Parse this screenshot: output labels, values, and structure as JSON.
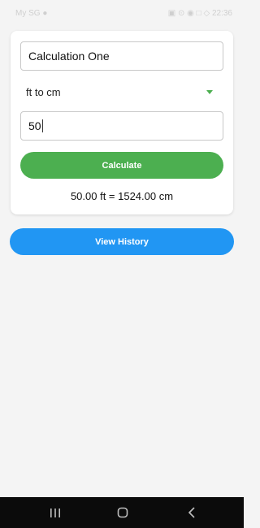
{
  "status_bar": {
    "left_text": "My SG ●",
    "right_text": "▣ ⊙ ◉ □ ◇ 22:36"
  },
  "form": {
    "name_value": "Calculation One",
    "conversion_selected": "ft to cm",
    "input_value": "50",
    "calculate_label": "Calculate",
    "result_text": "50.00 ft = 1524.00 cm"
  },
  "history_button_label": "View History",
  "colors": {
    "calculate_button": "#4caf50",
    "history_button": "#2196f3",
    "dropdown_arrow": "#4caf50"
  }
}
